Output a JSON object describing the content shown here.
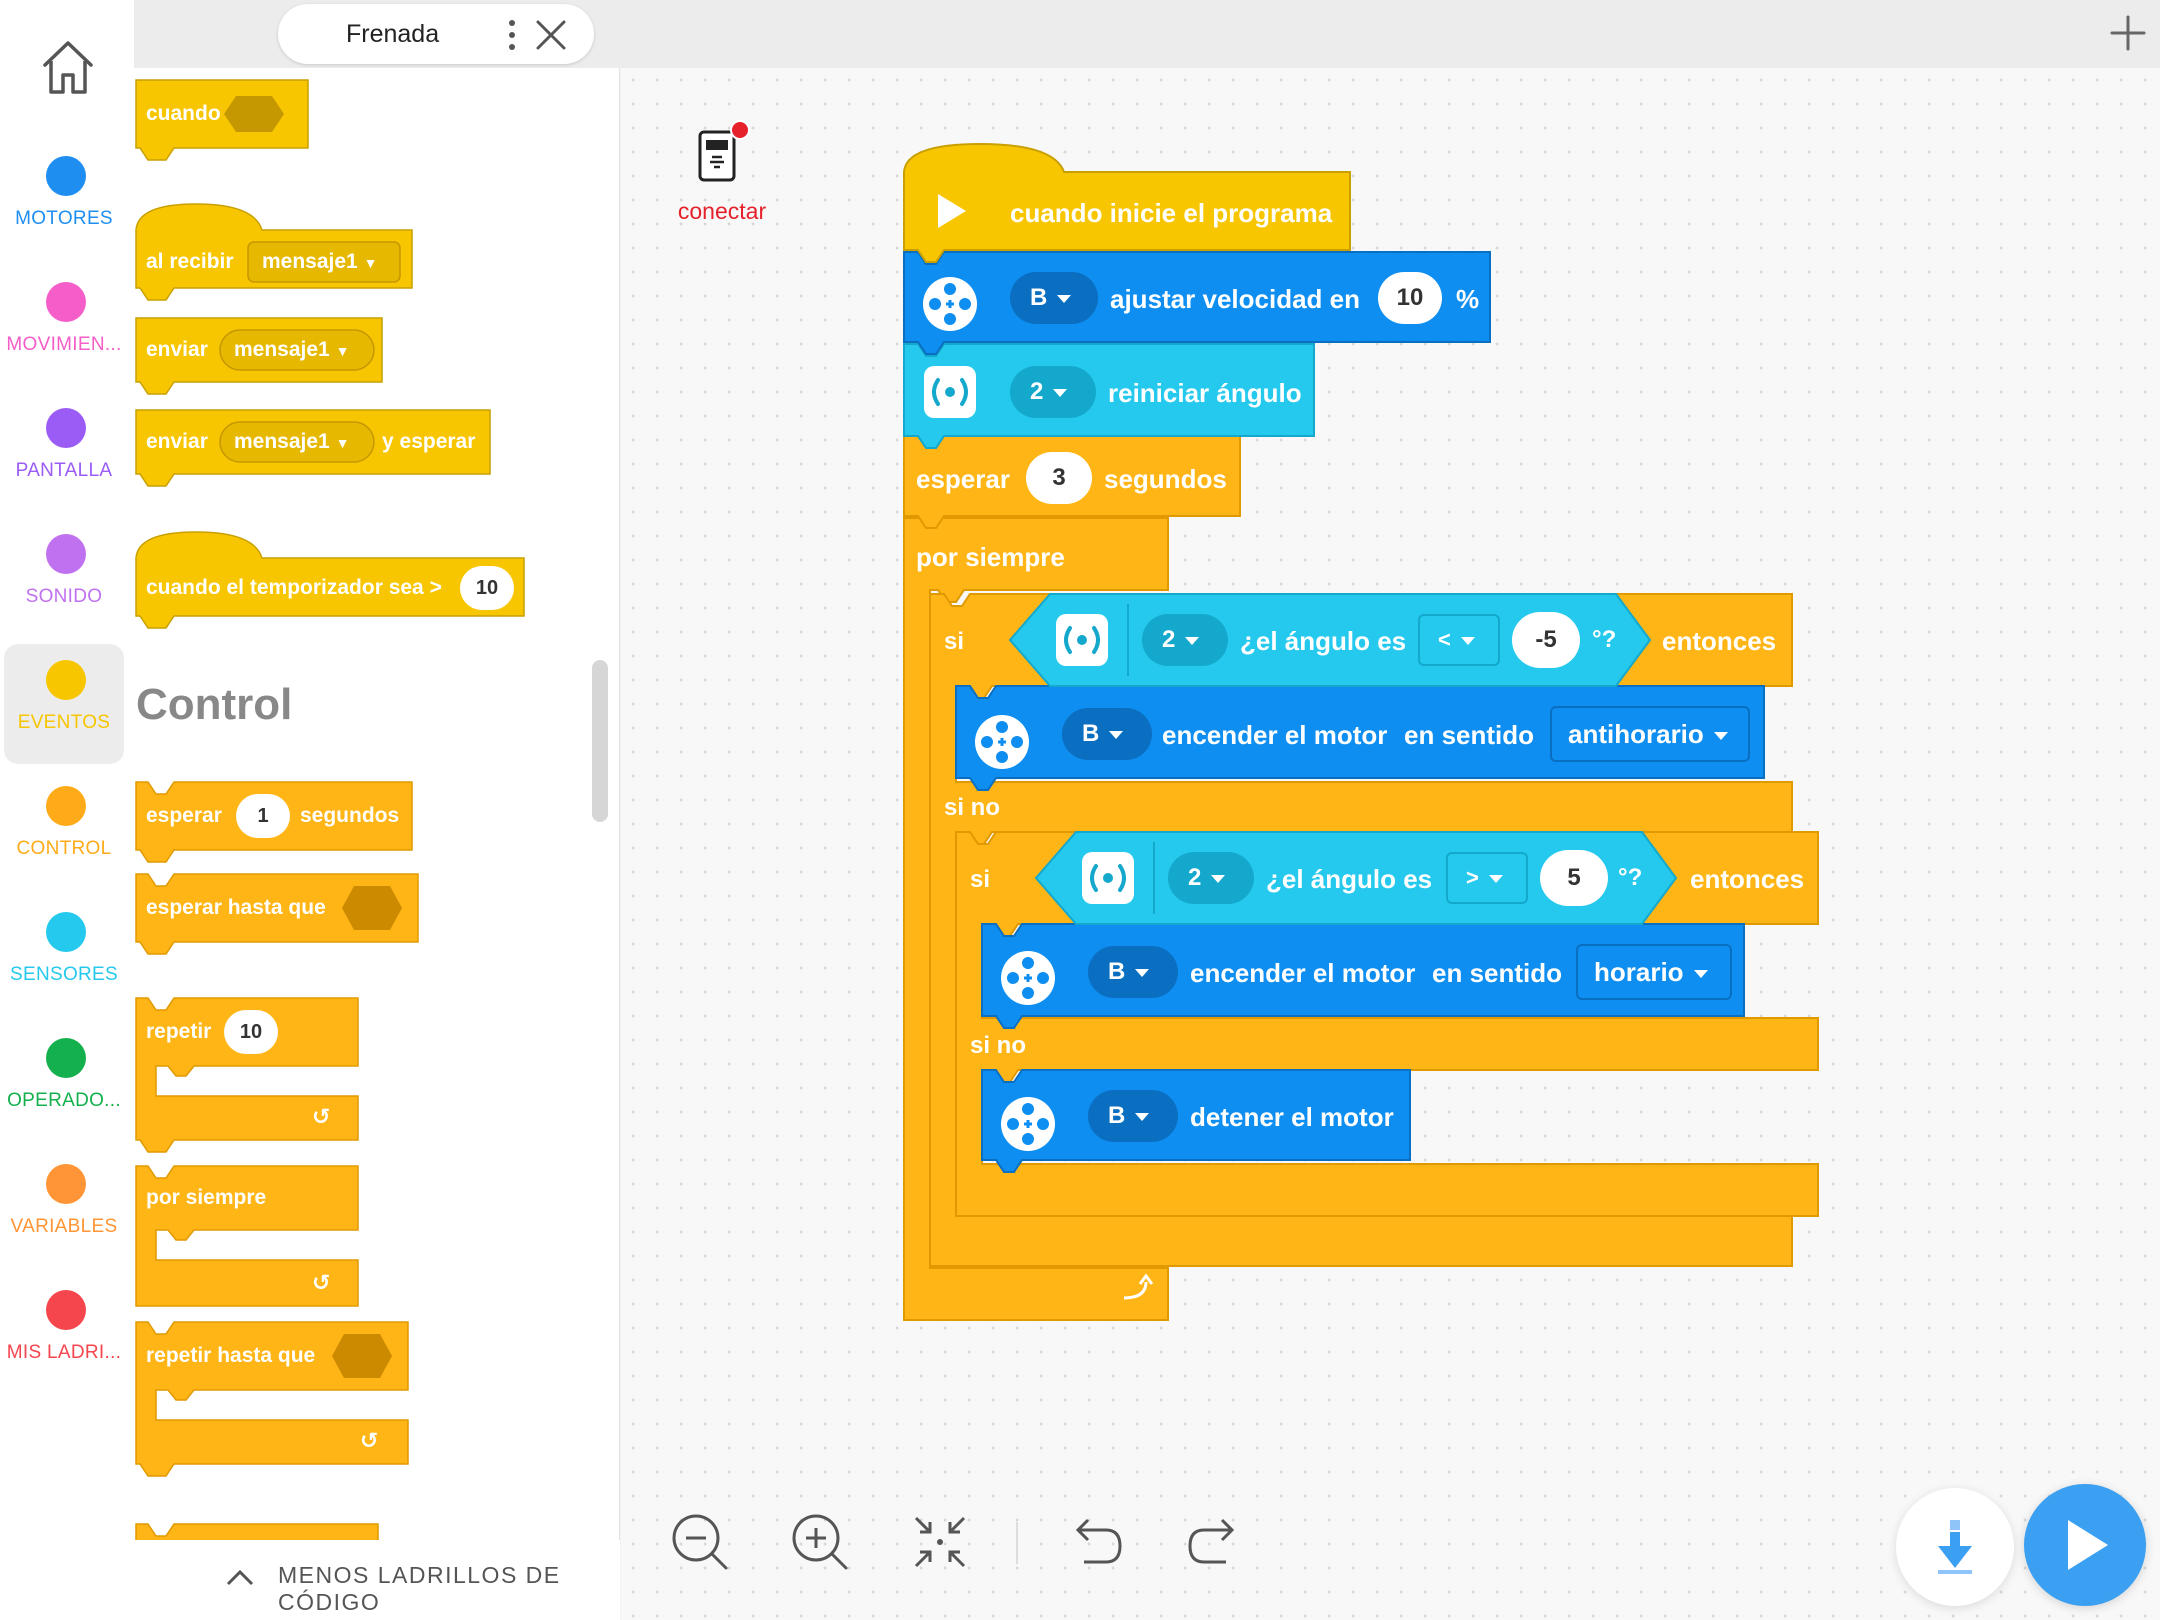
{
  "header": {
    "tab_title": "Frenada"
  },
  "categories": [
    {
      "label": "MOTORES",
      "color": "#1f8ef1"
    },
    {
      "label": "MOVIMIEN...",
      "color": "#f55ec8"
    },
    {
      "label": "PANTALLA",
      "color": "#9b5cf6"
    },
    {
      "label": "SONIDO",
      "color": "#c071ef"
    },
    {
      "label": "EVENTOS",
      "color": "#f7c600"
    },
    {
      "label": "CONTROL",
      "color": "#ffab19"
    },
    {
      "label": "SENSORES",
      "color": "#24c9ed"
    },
    {
      "label": "OPERADO...",
      "color": "#14b04e"
    },
    {
      "label": "VARIABLES",
      "color": "#ff9536"
    },
    {
      "label": "MIS LADRI...",
      "color": "#f5454d"
    }
  ],
  "palette": {
    "when": "cuando",
    "on_receive": "al recibir",
    "message": "mensaje1",
    "send": "enviar",
    "and_wait": "y esperar",
    "timer_when": "cuando el temporizador sea >",
    "timer_value": "10",
    "section_title": "Control",
    "wait": "esperar",
    "wait_value": "1",
    "seconds": "segundos",
    "wait_until": "esperar hasta que",
    "repeat": "repetir",
    "repeat_value": "10",
    "forever": "por siempre",
    "repeat_until": "repetir hasta que",
    "footer": "MENOS LADRILLOS DE CÓDIGO"
  },
  "program": {
    "connect_label": "conectar",
    "start": "cuando inicie el programa",
    "motor_port": "B",
    "set_speed": "ajustar velocidad en",
    "speed_value": "10",
    "percent": "%",
    "sensor_port": "2",
    "reset_angle": "reiniciar ángulo",
    "wait": "esperar",
    "wait_value": "3",
    "seconds": "segundos",
    "forever": "por siempre",
    "if": "si",
    "angle_q": "¿el ángulo es",
    "op_lt": "<",
    "val_neg5": "-5",
    "q_end": "°?",
    "then": "entonces",
    "motor_on": "encender el motor",
    "in_direction": "en sentido",
    "ccw": "antihorario",
    "else": "si no",
    "op_gt": ">",
    "val_5": "5",
    "cw": "horario",
    "stop_motor": "detener el motor"
  },
  "colors": {
    "event": "#f7c600",
    "control": "#ffb515",
    "motor": "#0e8ef0",
    "sensor": "#24c9ed"
  }
}
